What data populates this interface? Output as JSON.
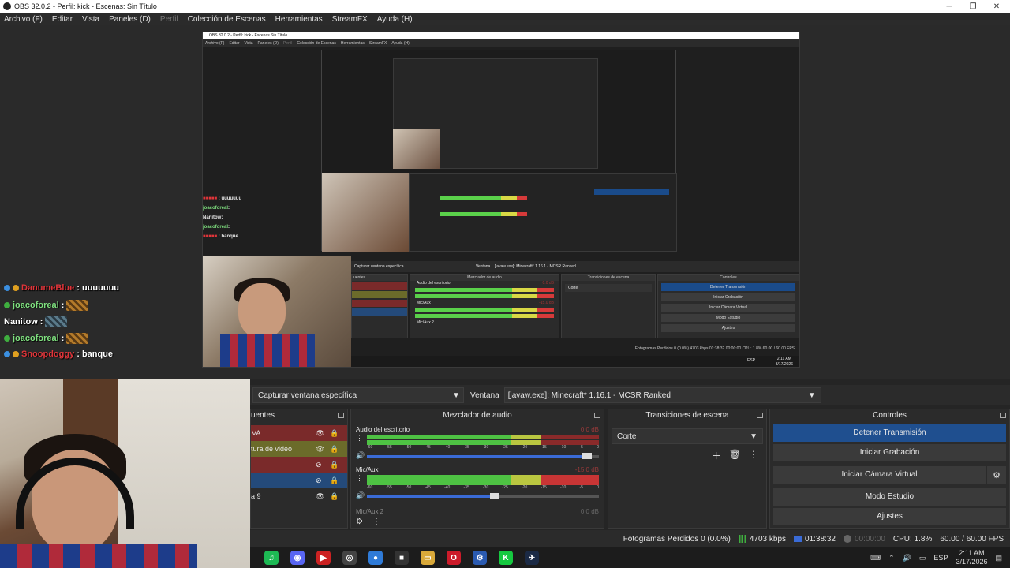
{
  "window": {
    "title": "OBS 32.0.2 - Perfil: kick - Escenas: Sin Título",
    "minimize_icon": "minimize-icon",
    "maximize_icon": "restore-icon",
    "close_icon": "close-icon"
  },
  "menu": {
    "items": [
      "Archivo (F)",
      "Editar",
      "Vista",
      "Paneles (D)",
      "Perfil",
      "Colección de Escenas",
      "Herramientas",
      "StreamFX",
      "Ayuda (H)"
    ]
  },
  "nested": {
    "title": "OBS 32.0.2 - Perfil: kick - Escenas Sin Título",
    "menu": [
      "Archivo (F)",
      "Editar",
      "Vista",
      "Paneles (D)",
      "Perfil",
      "Colección de Escenas",
      "Herramientas",
      "StreamFX",
      "Ayuda (H)"
    ],
    "source_label": "Capturar ventana específica",
    "window_label": "Ventana",
    "window_value": "[javaw.exe]: Minecraft* 1.16.1 - MCSR Ranked",
    "sources_hdr": "uentes",
    "mixer_hdr": "Mezclador de audio",
    "transitions_hdr": "Transiciones de escena",
    "controls_hdr": "Controles",
    "mixer_track1": "Audio del escritorio",
    "mixer_db1": "0.0 dB",
    "mixer_track2": "Mic/Aux",
    "mixer_db2": "-15.0 dB",
    "mixer_track3": "Mic/Aux 2",
    "transition": "Corte",
    "btn_stop": "Detener Transmisión",
    "btn_rec": "Iniciar Grabación",
    "btn_vcam": "Iniciar Cámara Virtual",
    "btn_studio": "Modo Estudio",
    "btn_settings": "Ajustes",
    "status": "Fotogramas Perdidos 0 (0.0%)   4703 kbps   01:38:32   00:00:00   CPU: 1.8%   60.00 / 60.00 FPS",
    "tray_lang": "ESP",
    "tray_time": "2:11 AM",
    "tray_date": "3/17/2026",
    "chat": [
      {
        "user": "joacoforeal",
        "msg": ":"
      },
      {
        "user": "Nanitow",
        "msg": ":"
      },
      {
        "user": "joacoforeal",
        "msg": ":"
      },
      {
        "user": "banque",
        "msg": ": banque"
      }
    ]
  },
  "chat": [
    {
      "user": "DanumeBlue",
      "msg": ": uuuuuuu",
      "color": "red",
      "badges": true
    },
    {
      "user": "joacoforeal",
      "msg": ":",
      "color": "green",
      "emote": true
    },
    {
      "user": "Nanitow",
      "msg": ":",
      "color": "white",
      "emote": true
    },
    {
      "user": "joacoforeal",
      "msg": ":",
      "color": "green",
      "emote": true
    },
    {
      "user": "Snoopdoggy",
      "msg": ": banque",
      "color": "red",
      "badges": true
    }
  ],
  "source_bar": {
    "source": "Capturar ventana específica",
    "window_label": "Ventana",
    "window_value": "[javaw.exe]: Minecraft* 1.16.1 - MCSR Ranked"
  },
  "sources": {
    "header": "uentes",
    "items": [
      {
        "label": "VA",
        "color": "#7a2a2a"
      },
      {
        "label": "tura de video",
        "color": "#6b6b2a"
      },
      {
        "label": "",
        "color": "#7a2a2a"
      },
      {
        "label": "",
        "color": "#244a7a"
      },
      {
        "label": "a 9",
        "color": "#2b2b2b"
      }
    ]
  },
  "mixer": {
    "header": "Mezclador de audio",
    "tracks": [
      {
        "name": "Audio del escritorio",
        "db": "0.0 dB",
        "volume": 1.0
      },
      {
        "name": "Mic/Aux",
        "db": "-15.0 dB",
        "volume": 0.55
      },
      {
        "name": "Mic/Aux 2",
        "db": "0.0 dB",
        "volume": 1.0
      }
    ],
    "scale": [
      "-60",
      "-55",
      "-50",
      "-45",
      "-40",
      "-35",
      "-30",
      "-25",
      "-20",
      "-15",
      "-10",
      "-5",
      "0"
    ]
  },
  "transitions": {
    "header": "Transiciones de escena",
    "selected": "Corte"
  },
  "controls": {
    "header": "Controles",
    "stop_stream": "Detener Transmisión",
    "start_recording": "Iniciar Grabación",
    "start_virtual_cam": "Iniciar Cámara Virtual",
    "studio_mode": "Modo Estudio",
    "settings": "Ajustes"
  },
  "status": {
    "dropped": "Fotogramas Perdidos 0 (0.0%)",
    "bitrate": "4703 kbps",
    "stream_time": "01:38:32",
    "rec_time": "00:00:00",
    "cpu": "CPU: 1.8%",
    "fps": "60.00 / 60.00 FPS"
  },
  "taskbar": {
    "apps": [
      {
        "icon": "spotify-icon",
        "color": "#1db954",
        "glyph": "♫"
      },
      {
        "icon": "discord-icon",
        "color": "#5865f2",
        "glyph": "◉"
      },
      {
        "icon": "youtube-icon",
        "color": "#cc2222",
        "glyph": "▶"
      },
      {
        "icon": "obs-icon",
        "color": "#444444",
        "glyph": "◎"
      },
      {
        "icon": "chrome-icon",
        "color": "#2f7bd8",
        "glyph": "●"
      },
      {
        "icon": "app-icon",
        "color": "#333333",
        "glyph": "■"
      },
      {
        "icon": "folder-icon",
        "color": "#d9a93a",
        "glyph": "▭"
      },
      {
        "icon": "opera-icon",
        "color": "#cc1b2a",
        "glyph": "O"
      },
      {
        "icon": "settings-icon",
        "color": "#2a5ab0",
        "glyph": "⚙"
      },
      {
        "icon": "kick-icon",
        "color": "#16c940",
        "glyph": "K"
      },
      {
        "icon": "steam-icon",
        "color": "#1b2a45",
        "glyph": "✈"
      }
    ],
    "lang": "ESP",
    "time": "2:11 AM",
    "date": "3/17/2026"
  }
}
